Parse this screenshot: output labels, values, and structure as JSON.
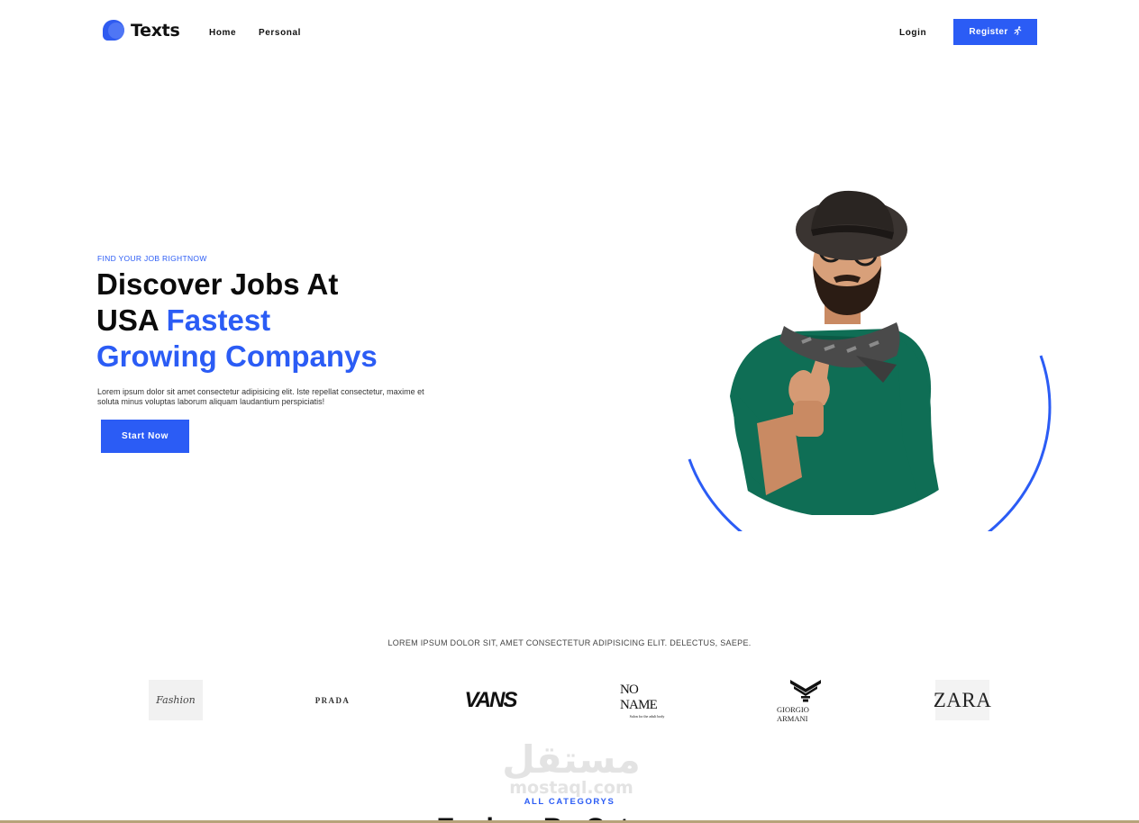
{
  "nav": {
    "brand": "Texts",
    "links": [
      "Home",
      "Personal"
    ],
    "login": "Login",
    "register": "Register",
    "register_icon": "running-person-icon"
  },
  "hero": {
    "eyebrow": "FIND YOUR JOB RIGHTNOW",
    "title_line1": "Discover Jobs At",
    "title_line2_plain": "USA ",
    "title_line2_accent": "Fastest",
    "title_line3_accent": "Growing Companys",
    "description": "Lorem ipsum dolor sit amet consectetur adipisicing elit. Iste repellat consectetur, maxime et soluta minus voluptas laborum aliquam laudantium perspiciatis!",
    "cta": "Start Now",
    "image": "man-with-hat-thumbs-up-photo"
  },
  "brands": {
    "caption": "LOREM IPSUM DOLOR SIT, AMET CONSECTETUR ADIPISICING ELIT. DELECTUS, SAEPE.",
    "items": [
      "Fashion",
      "PRADA",
      "VANS",
      "NO NAME",
      "GIORGIO ARMANI",
      "ZARA"
    ],
    "noname_tagline": "Salon for the adult body"
  },
  "watermark": {
    "arabic": "مستقل",
    "latin": "mostaql.com"
  },
  "categories": {
    "eyebrow": "ALL CATEGORYS",
    "title": "Explore By Category"
  },
  "colors": {
    "accent": "#2b5cf5",
    "text": "#0b0b0b",
    "sweater": "#0f6e55"
  }
}
